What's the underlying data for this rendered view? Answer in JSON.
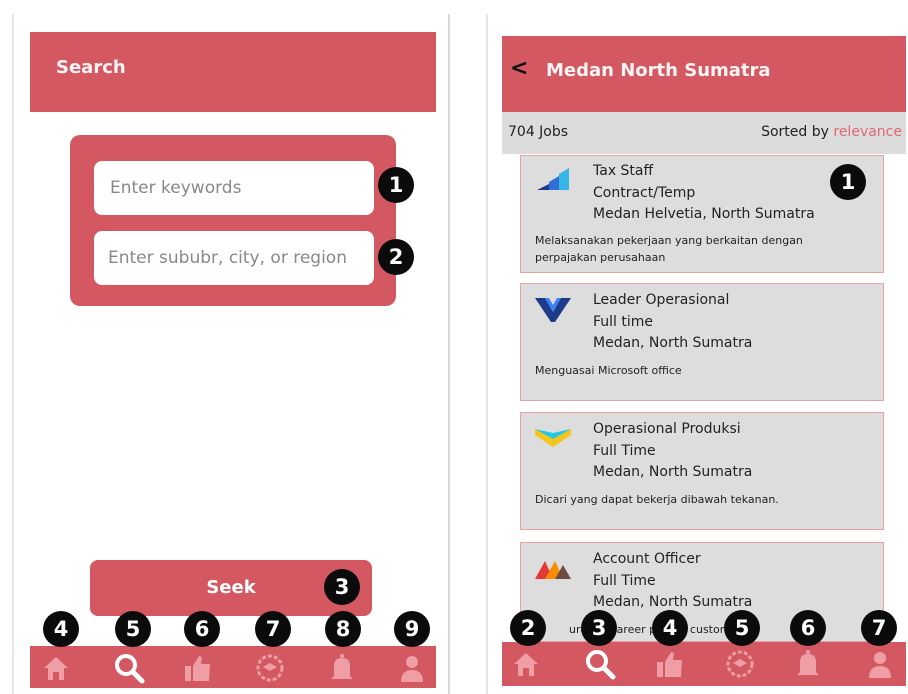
{
  "left_screen": {
    "header": {
      "title": "Search"
    },
    "search": {
      "keywords_placeholder": "Enter keywords",
      "location_placeholder": "Enter sububr, city, or region"
    },
    "seek_button": {
      "label": "Seek"
    },
    "badges": [
      "1",
      "2",
      "3",
      "4",
      "5",
      "6",
      "7",
      "8",
      "9"
    ],
    "nav": [
      "home-icon",
      "search-icon",
      "thumbs-up-icon",
      "badge-icon",
      "bell-icon",
      "user-icon"
    ]
  },
  "right_screen": {
    "header": {
      "back": "<",
      "title": "Medan North Sumatra"
    },
    "results": {
      "count": "704 Jobs",
      "sorted_label": "Sorted by",
      "sorted_value": "relevance"
    },
    "jobs": [
      {
        "title": "Tax Staff",
        "type": "Contract/Temp",
        "location": "Medan Helvetia, North Sumatra",
        "description": "Melaksanakan pekerjaan yang berkaitan dengan perpajakan perusahaan"
      },
      {
        "title": "Leader Operasional",
        "type": "Full time",
        "location": "Medan, North Sumatra",
        "description": "Menguasai Microsoft office"
      },
      {
        "title": "Operasional Produksi",
        "type": "Full Time",
        "location": "Medan, North Sumatra",
        "description": "Dicari yang dapat bekerja dibawah tekanan."
      },
      {
        "title": "Account Officer",
        "type": "Full Time",
        "location": "Medan, North Sumatra",
        "description": "urance career people customer"
      }
    ],
    "badges": [
      "1",
      "2",
      "3",
      "4",
      "5",
      "6",
      "7"
    ],
    "nav": [
      "home-icon",
      "search-icon",
      "thumbs-up-icon",
      "badge-icon",
      "bell-icon",
      "user-icon"
    ]
  },
  "colors": {
    "accent": "#d45862",
    "card_bg": "#dddddd",
    "relevance": "#e0676f",
    "badge": "#0b0b0b"
  }
}
